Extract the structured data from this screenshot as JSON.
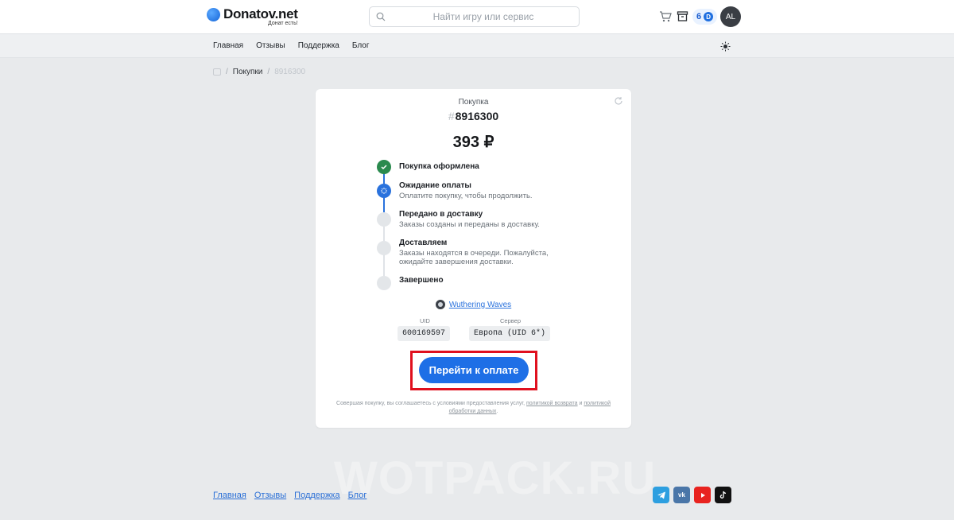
{
  "header": {
    "logo_name": "Donatov.net",
    "logo_tagline": "Донат есть!",
    "search_placeholder": "Найти игру или сервис",
    "balance": "6",
    "coin_symbol": "D",
    "avatar_initials": "AL"
  },
  "nav": {
    "items": [
      {
        "label": "Главная"
      },
      {
        "label": "Отзывы"
      },
      {
        "label": "Поддержка"
      },
      {
        "label": "Блог"
      }
    ]
  },
  "breadcrumb": {
    "purchases": "Покупки",
    "current": "8916300"
  },
  "order": {
    "label": "Покупка",
    "hash": "#",
    "id": "8916300",
    "price": "393 ₽",
    "steps": [
      {
        "title": "Покупка оформлена",
        "desc": "",
        "state": "done"
      },
      {
        "title": "Ожидание оплаты",
        "desc": "Оплатите покупку, чтобы продолжить.",
        "state": "current"
      },
      {
        "title": "Передано в доставку",
        "desc": "Заказы созданы и переданы в доставку.",
        "state": "pending"
      },
      {
        "title": "Доставляем",
        "desc": "Заказы находятся в очереди. Пожалуйста, ожидайте завершения доставки.",
        "state": "pending"
      },
      {
        "title": "Завершено",
        "desc": "",
        "state": "pending"
      }
    ],
    "game": "Wuthering Waves",
    "uid_label": "UID",
    "uid_value": "600169597",
    "server_label": "Сервер",
    "server_value": "Европа (UID 6*)",
    "pay_button": "Перейти к оплате",
    "legal_prefix": "Совершая покупку, вы соглашаетесь с условиями предоставления услуг,",
    "legal_link1": "политикой возврата",
    "legal_and": "и",
    "legal_link2": "политикой обработки данных",
    "legal_end": "."
  },
  "watermark": "WOTPACK.RU",
  "footer": {
    "links": [
      {
        "label": "Главная"
      },
      {
        "label": "Отзывы"
      },
      {
        "label": "Поддержка"
      },
      {
        "label": "Блог"
      }
    ],
    "socials": [
      "telegram-icon",
      "vk-icon",
      "youtube-icon",
      "tiktok-icon"
    ]
  },
  "colors": {
    "accent": "#1e6fe6",
    "done": "#2a8a4e",
    "highlight": "#e0101e"
  }
}
